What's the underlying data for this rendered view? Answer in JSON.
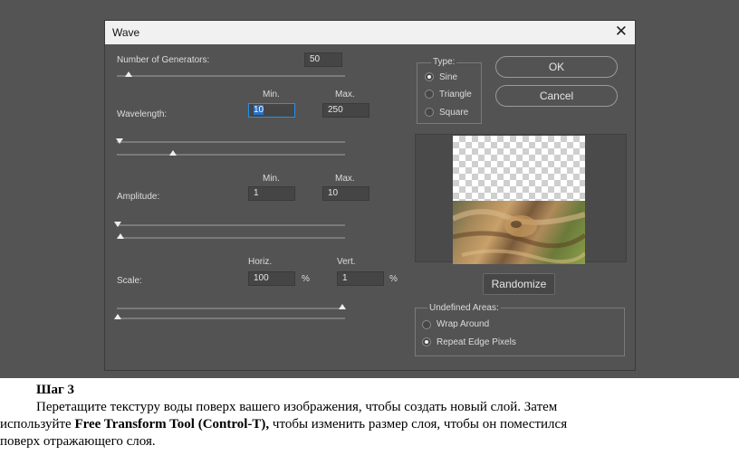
{
  "dialog": {
    "title": "Wave",
    "close_glyph": "✕",
    "generators": {
      "label": "Number of Generators:",
      "value": "50"
    },
    "wavelength": {
      "label": "Wavelength:",
      "min_label": "Min.",
      "max_label": "Max.",
      "min": "10",
      "max": "250"
    },
    "amplitude": {
      "label": "Amplitude:",
      "min_label": "Min.",
      "max_label": "Max.",
      "min": "1",
      "max": "10"
    },
    "scale": {
      "label": "Scale:",
      "horiz_label": "Horiz.",
      "vert_label": "Vert.",
      "horiz": "100",
      "vert": "1",
      "unit": "%"
    },
    "type": {
      "legend": "Type:",
      "options": [
        "Sine",
        "Triangle",
        "Square"
      ],
      "selected": "Sine"
    },
    "buttons": {
      "ok": "OK",
      "cancel": "Cancel",
      "randomize": "Randomize"
    },
    "undefined_areas": {
      "legend": "Undefined Areas:",
      "options": [
        "Wrap Around",
        "Repeat Edge Pixels"
      ],
      "selected": "Repeat Edge Pixels"
    }
  },
  "caption": {
    "heading": "Шаг 3",
    "line1": "Перетащите текстуру воды поверх вашего изображения, чтобы создать новый слой. Затем",
    "line2_pre": "используйте ",
    "line2_bold": "Free Transform Tool (Control-T),",
    "line2_post": " чтобы изменить размер слоя, чтобы он поместился",
    "line3": "поверх отражающего слоя."
  },
  "icons": {
    "close": "close-icon"
  }
}
